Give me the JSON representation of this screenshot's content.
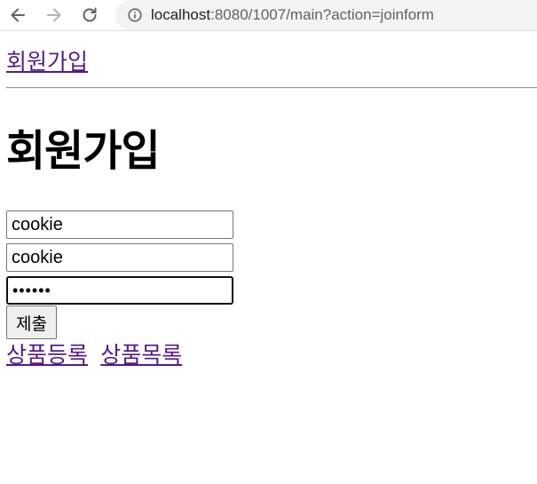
{
  "browser": {
    "url_host": "localhost",
    "url_path": ":8080/1007/main?action=joinform",
    "icons": {
      "back": "arrow-left-icon",
      "forward": "arrow-right-icon",
      "reload": "reload-icon",
      "info": "info-icon"
    }
  },
  "page": {
    "top_link": "회원가입",
    "heading": "회원가입",
    "form": {
      "field1_value": "cookie",
      "field2_value": "cookie",
      "password_value": "••••••",
      "submit_label": "제출"
    },
    "bottom_links": [
      "상품등록",
      "상품목록"
    ]
  },
  "colors": {
    "visited_link": "#551a8b",
    "omnibox_bg": "#f1f3f4"
  }
}
